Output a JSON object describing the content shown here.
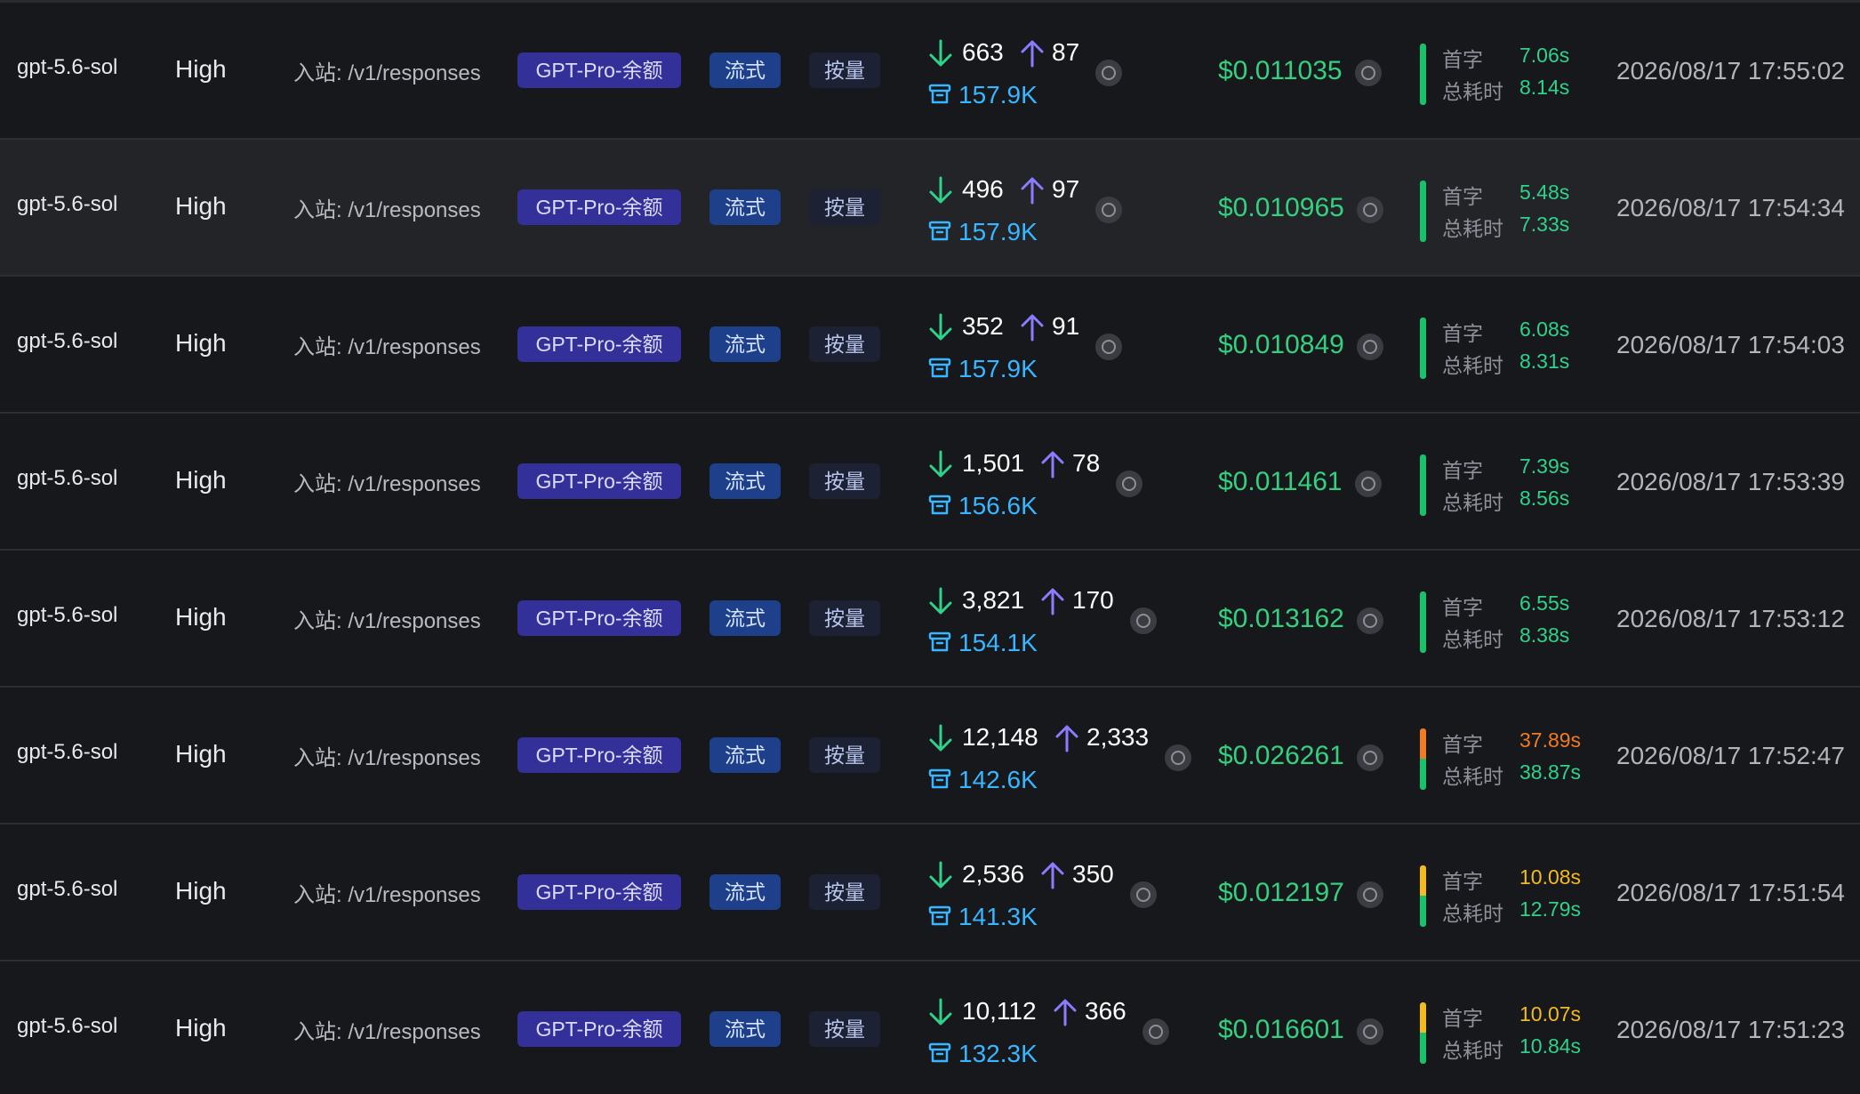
{
  "labels": {
    "first_token": "首字",
    "total_time": "总耗时"
  },
  "colors": {
    "green": "#17c26a",
    "orange": "#f07b22",
    "yellow": "#f3bb1d",
    "cost": "#35d07f",
    "cache": "#38b6ff",
    "group_tag": "#33309a",
    "stream_tag": "#1e3f8a",
    "billing_tag": "#1c2234"
  },
  "icons": {
    "input_tokens": "arrow-down-icon",
    "output_tokens": "arrow-up-icon",
    "cache": "cache-box-icon",
    "info": "info-icon"
  },
  "rows": [
    {
      "model": "gpt-5.6-sol",
      "effort": "High",
      "route": "入站: /v1/responses",
      "group": "GPT-Pro-余额",
      "stream": "流式",
      "billing": "按量",
      "tokens_in": "663",
      "tokens_out": "87",
      "cache": "157.9K",
      "cost": "$0.011035",
      "first_token": "7.06s",
      "total_time": "8.14s",
      "first_level": "green",
      "time": "2026/08/17 17:55:02",
      "hover": false
    },
    {
      "model": "gpt-5.6-sol",
      "effort": "High",
      "route": "入站: /v1/responses",
      "group": "GPT-Pro-余额",
      "stream": "流式",
      "billing": "按量",
      "tokens_in": "496",
      "tokens_out": "97",
      "cache": "157.9K",
      "cost": "$0.010965",
      "first_token": "5.48s",
      "total_time": "7.33s",
      "first_level": "green",
      "time": "2026/08/17 17:54:34",
      "hover": true
    },
    {
      "model": "gpt-5.6-sol",
      "effort": "High",
      "route": "入站: /v1/responses",
      "group": "GPT-Pro-余额",
      "stream": "流式",
      "billing": "按量",
      "tokens_in": "352",
      "tokens_out": "91",
      "cache": "157.9K",
      "cost": "$0.010849",
      "first_token": "6.08s",
      "total_time": "8.31s",
      "first_level": "green",
      "time": "2026/08/17 17:54:03",
      "hover": false
    },
    {
      "model": "gpt-5.6-sol",
      "effort": "High",
      "route": "入站: /v1/responses",
      "group": "GPT-Pro-余额",
      "stream": "流式",
      "billing": "按量",
      "tokens_in": "1,501",
      "tokens_out": "78",
      "cache": "156.6K",
      "cost": "$0.011461",
      "first_token": "7.39s",
      "total_time": "8.56s",
      "first_level": "green",
      "time": "2026/08/17 17:53:39",
      "hover": false
    },
    {
      "model": "gpt-5.6-sol",
      "effort": "High",
      "route": "入站: /v1/responses",
      "group": "GPT-Pro-余额",
      "stream": "流式",
      "billing": "按量",
      "tokens_in": "3,821",
      "tokens_out": "170",
      "cache": "154.1K",
      "cost": "$0.013162",
      "first_token": "6.55s",
      "total_time": "8.38s",
      "first_level": "green",
      "time": "2026/08/17 17:53:12",
      "hover": false
    },
    {
      "model": "gpt-5.6-sol",
      "effort": "High",
      "route": "入站: /v1/responses",
      "group": "GPT-Pro-余额",
      "stream": "流式",
      "billing": "按量",
      "tokens_in": "12,148",
      "tokens_out": "2,333",
      "cache": "142.6K",
      "cost": "$0.026261",
      "first_token": "37.89s",
      "total_time": "38.87s",
      "first_level": "orange",
      "time": "2026/08/17 17:52:47",
      "hover": false
    },
    {
      "model": "gpt-5.6-sol",
      "effort": "High",
      "route": "入站: /v1/responses",
      "group": "GPT-Pro-余额",
      "stream": "流式",
      "billing": "按量",
      "tokens_in": "2,536",
      "tokens_out": "350",
      "cache": "141.3K",
      "cost": "$0.012197",
      "first_token": "10.08s",
      "total_time": "12.79s",
      "first_level": "yellow",
      "time": "2026/08/17 17:51:54",
      "hover": false
    },
    {
      "model": "gpt-5.6-sol",
      "effort": "High",
      "route": "入站: /v1/responses",
      "group": "GPT-Pro-余额",
      "stream": "流式",
      "billing": "按量",
      "tokens_in": "10,112",
      "tokens_out": "366",
      "cache": "132.3K",
      "cost": "$0.016601",
      "first_token": "10.07s",
      "total_time": "10.84s",
      "first_level": "yellow",
      "time": "2026/08/17 17:51:23",
      "hover": false
    }
  ]
}
